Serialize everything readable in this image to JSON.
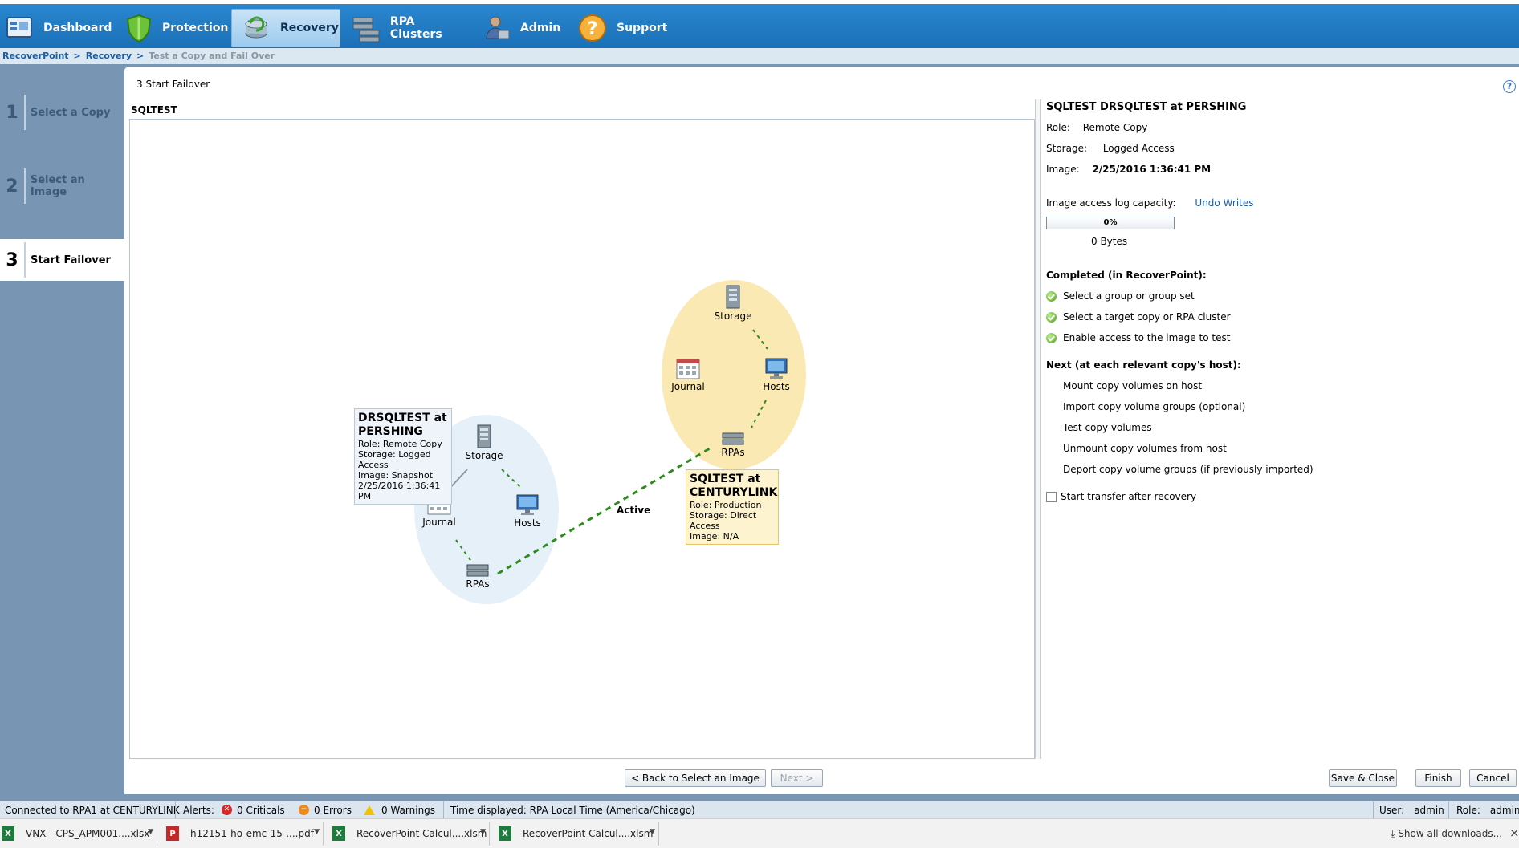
{
  "nav": {
    "items": [
      {
        "label": "Dashboard",
        "icon": "dashboard-icon"
      },
      {
        "label": "Protection",
        "icon": "shield-icon"
      },
      {
        "label": "Recovery",
        "icon": "recovery-icon"
      },
      {
        "label": "RPA Clusters",
        "icon": "rpa-clusters-icon"
      },
      {
        "label": "Admin",
        "icon": "admin-icon"
      },
      {
        "label": "Support",
        "icon": "support-icon"
      }
    ],
    "active": "Recovery"
  },
  "breadcrumb": {
    "root": "RecoverPoint",
    "sep": ">",
    "section": "Recovery",
    "current": "Test a Copy and Fail Over"
  },
  "wizard": {
    "steps": [
      {
        "num": "1",
        "label": "Select a Copy"
      },
      {
        "num": "2",
        "label": "Select an Image"
      },
      {
        "num": "3",
        "label": "Start Failover"
      }
    ],
    "active_step": 3
  },
  "page": {
    "title": "3  Start Failover",
    "group": "SQLTEST"
  },
  "diagram": {
    "link_label": "Active",
    "remote": {
      "title_line1": "DRSQLTEST at",
      "title_line2": "PERSHING",
      "role": "Role: Remote Copy",
      "storage": "Storage: Logged Access",
      "image": "Image: Snapshot",
      "date": "2/25/2016 1:36:41 PM",
      "nodes": {
        "storage": "Storage",
        "journal": "Journal",
        "hosts": "Hosts",
        "rpas": "RPAs"
      }
    },
    "production": {
      "title_line1": "SQLTEST at",
      "title_line2": "CENTURYLINK",
      "role": "Role: Production",
      "storage": "Storage: Direct Access",
      "image": "Image: N/A",
      "nodes": {
        "storage": "Storage",
        "journal": "Journal",
        "hosts": "Hosts",
        "rpas": "RPAs"
      }
    }
  },
  "details": {
    "heading": "SQLTEST DRSQLTEST at PERSHING",
    "role_label": "Role:",
    "role_value": "Remote Copy",
    "storage_label": "Storage:",
    "storage_value": "Logged Access",
    "image_label": "Image:",
    "image_value": "2/25/2016 1:36:41 PM",
    "log_capacity_label": "Image access log capacity:",
    "undo_writes": "Undo Writes",
    "progress_text": "0%",
    "progress_fraction": 0,
    "bytes": "0 Bytes",
    "completed_heading": "Completed (in RecoverPoint):",
    "completed": [
      "Select a group or group set",
      "Select a target copy or RPA cluster",
      "Enable access to the image to test"
    ],
    "next_heading": "Next (at each relevant copy's host):",
    "next": [
      "Mount copy volumes on host",
      "Import copy volume groups (optional)",
      "Test copy volumes",
      "Unmount copy volumes from host",
      "Deport copy volume groups (if previously imported)"
    ],
    "start_transfer_label": "Start transfer after recovery",
    "start_transfer_checked": false
  },
  "buttons": {
    "back": "< Back to Select an Image",
    "next": "Next >",
    "save_close": "Save & Close",
    "finish": "Finish",
    "cancel": "Cancel"
  },
  "status": {
    "connected": "Connected to RPA1 at CENTURYLINK",
    "alerts_label": "Alerts:",
    "criticals": "0 Criticals",
    "errors": "0 Errors",
    "warnings": "0 Warnings",
    "time_displayed": "Time displayed: RPA Local Time (America/Chicago)",
    "user_label": "User:",
    "user_value": "admin",
    "role_label": "Role:",
    "role_value": "admin"
  },
  "downloads": {
    "files": [
      {
        "name": "VNX - CPS_APM001....xlsx",
        "type": "excel"
      },
      {
        "name": "h12151-ho-emc-15-....pdf",
        "type": "pdf"
      },
      {
        "name": "RecoverPoint Calcul....xlsm",
        "type": "excel"
      },
      {
        "name": "RecoverPoint Calcul....xlsm",
        "type": "excel"
      }
    ],
    "show_all": "Show all downloads...",
    "close": "×"
  },
  "colors": {
    "nav_blue": "#1a70b8",
    "sidebar": "#7895b3",
    "remote_bubble": "#e6f0f8",
    "production_bubble": "#fbe9b4",
    "link_green": "#2e8b1e",
    "check_green": "#4f9f1a"
  }
}
